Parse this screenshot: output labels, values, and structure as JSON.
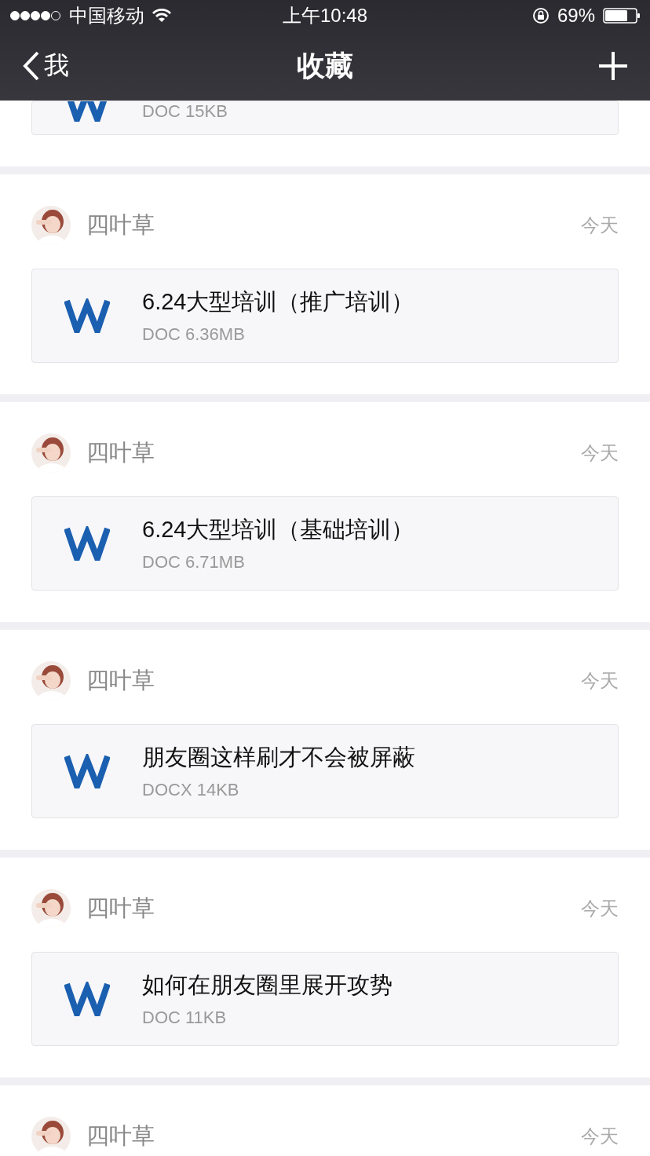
{
  "status_bar": {
    "carrier": "中国移动",
    "time": "上午10:48",
    "battery": "69%"
  },
  "nav": {
    "back": "我",
    "title": "收藏"
  },
  "items": [
    {
      "kind": "partial",
      "size": "DOC 15KB"
    },
    {
      "kind": "full",
      "author": "四叶草",
      "time": "今天",
      "title": "6.24大型培训（推广培训）",
      "size": "DOC 6.36MB"
    },
    {
      "kind": "full",
      "author": "四叶草",
      "time": "今天",
      "title": "6.24大型培训（基础培训）",
      "size": "DOC 6.71MB"
    },
    {
      "kind": "full",
      "author": "四叶草",
      "time": "今天",
      "title": "朋友圈这样刷才不会被屏蔽",
      "size": "DOCX 14KB"
    },
    {
      "kind": "full",
      "author": "四叶草",
      "time": "今天",
      "title": "如何在朋友圈里展开攻势",
      "size": "DOC 11KB"
    },
    {
      "kind": "header",
      "author": "四叶草",
      "time": "今天"
    }
  ]
}
